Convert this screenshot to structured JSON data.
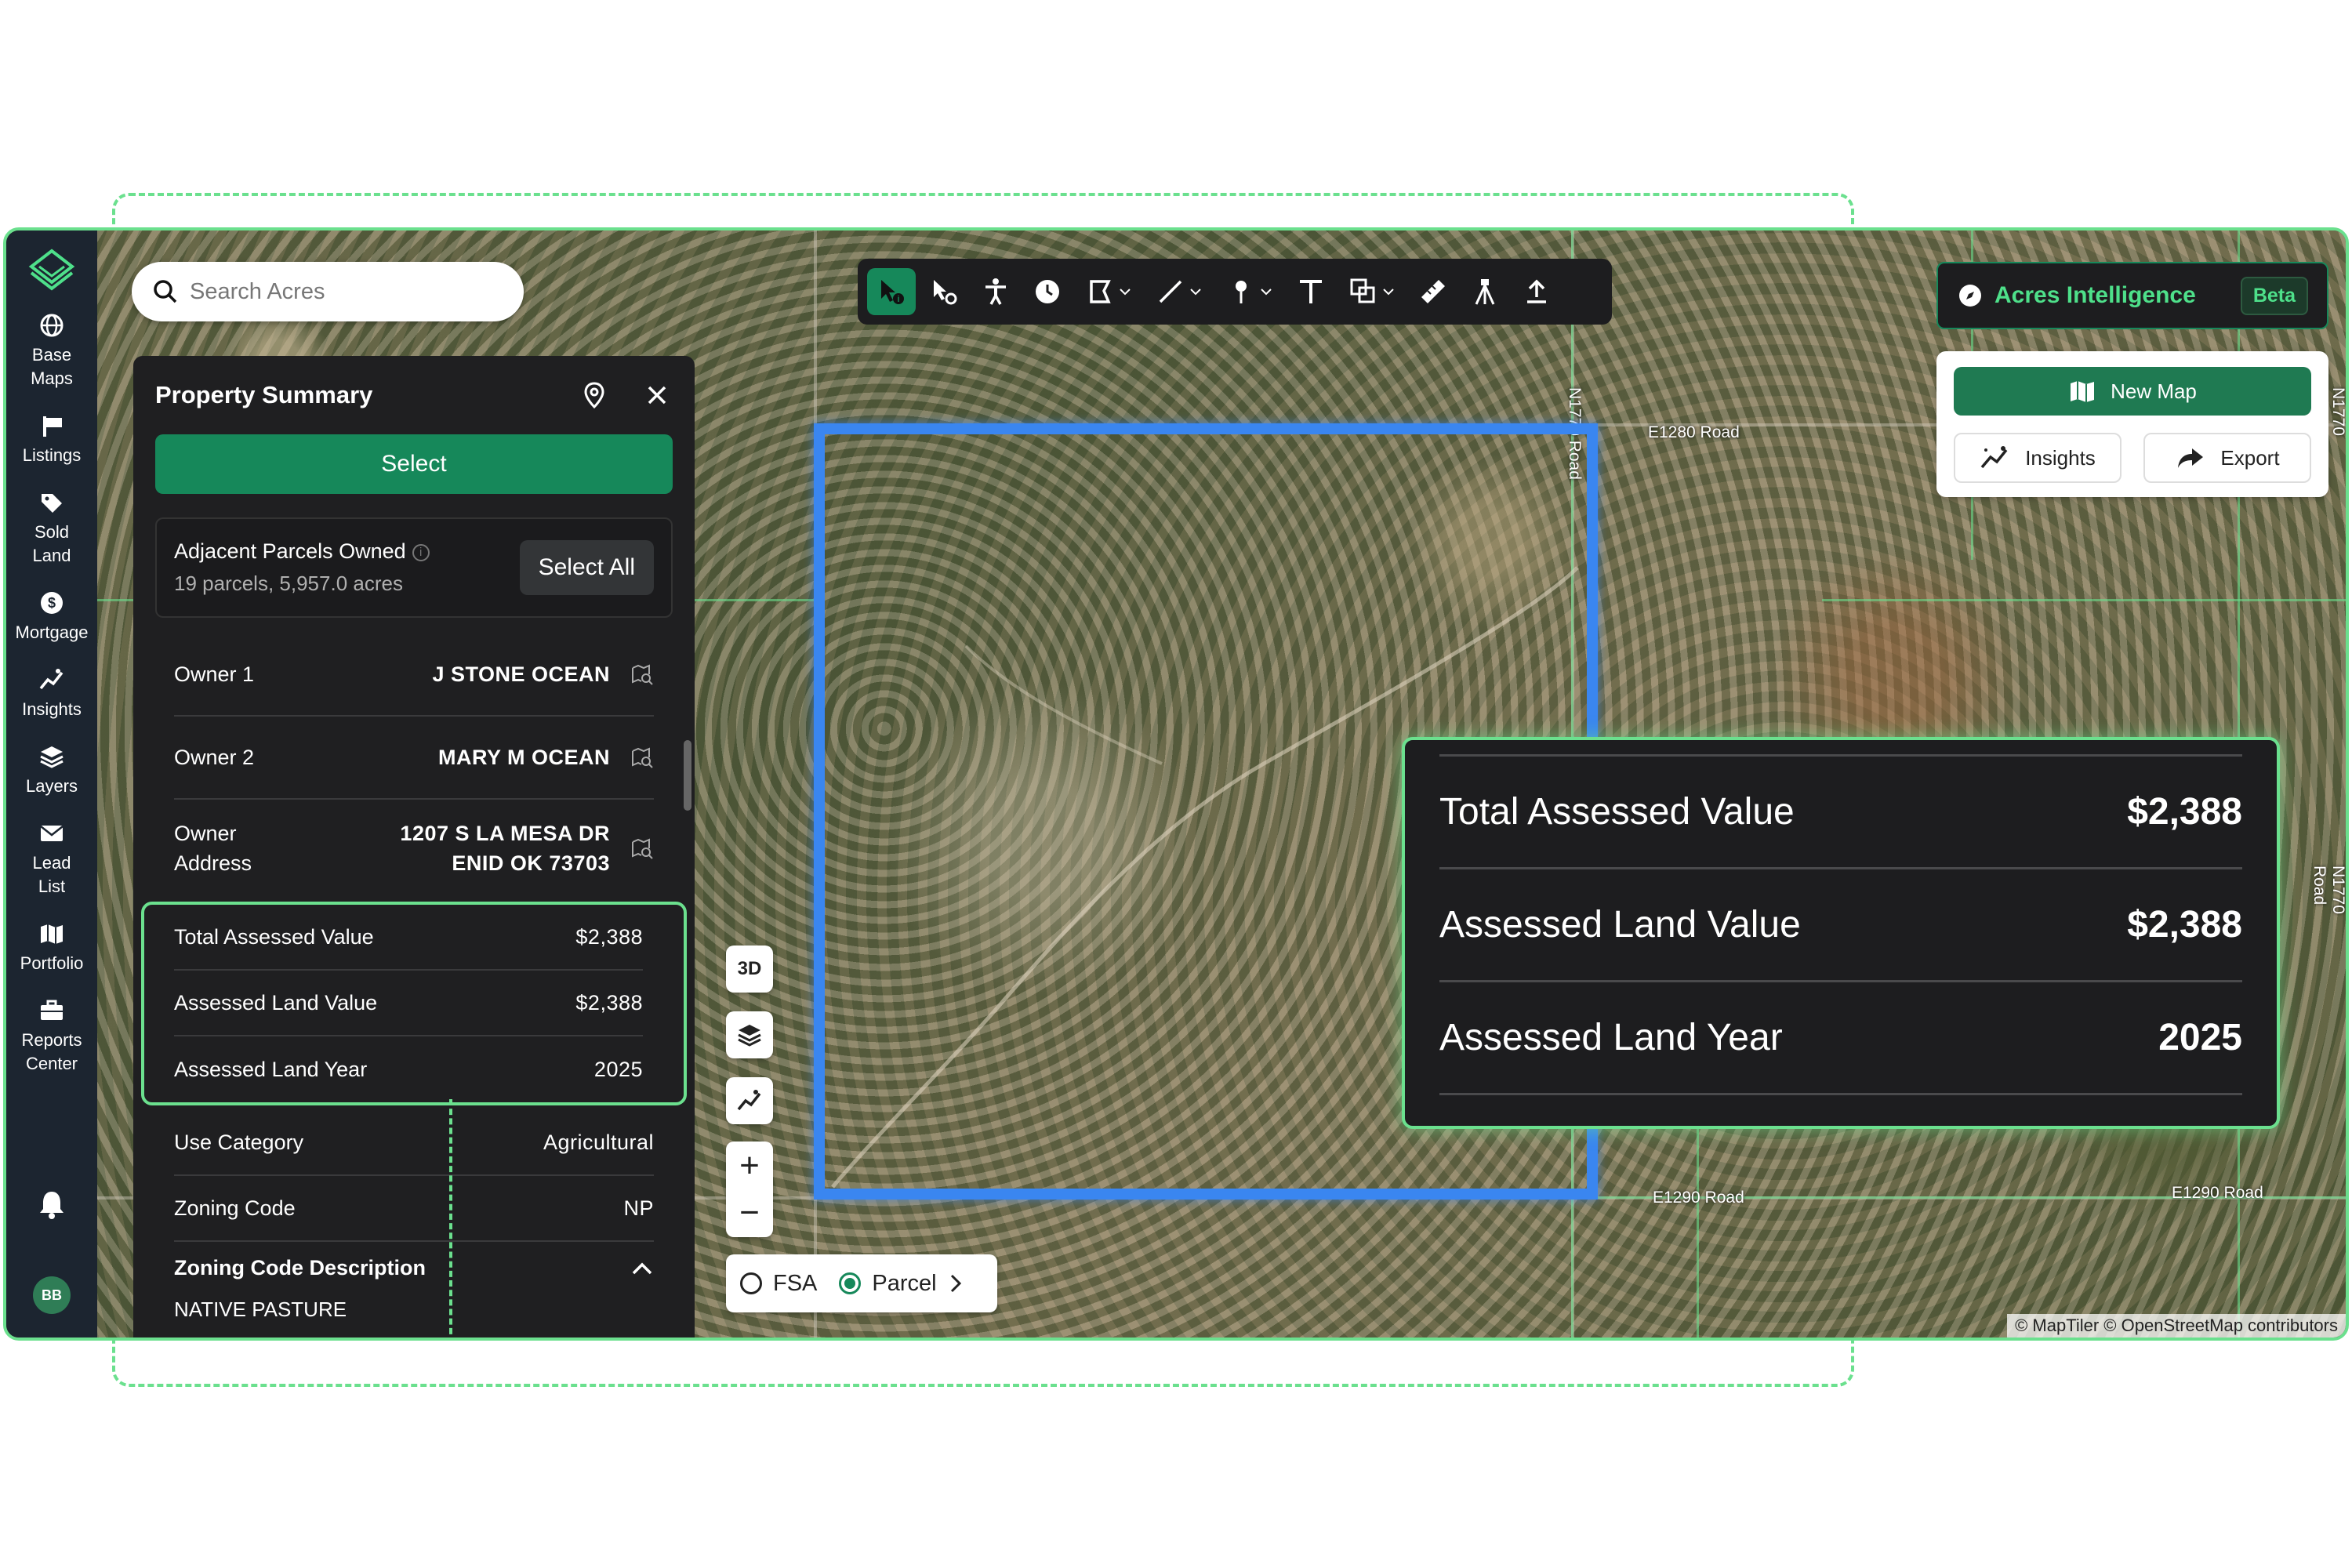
{
  "search": {
    "placeholder": "Search Acres"
  },
  "nav": {
    "items": [
      {
        "label": "Base\nMaps",
        "icon": "globe-icon"
      },
      {
        "label": "Listings",
        "icon": "listings-icon"
      },
      {
        "label": "Sold\nLand",
        "icon": "tag-icon"
      },
      {
        "label": "Mortgage",
        "icon": "dollar-icon"
      },
      {
        "label": "Insights",
        "icon": "insights-icon"
      },
      {
        "label": "Layers",
        "icon": "layers-icon"
      },
      {
        "label": "Lead\nList",
        "icon": "mail-icon"
      },
      {
        "label": "Portfolio",
        "icon": "map-icon"
      },
      {
        "label": "Reports\nCenter",
        "icon": "briefcase-icon"
      }
    ],
    "avatar": "BB"
  },
  "panel": {
    "title": "Property Summary",
    "select_label": "Select",
    "adjacent": {
      "title": "Adjacent Parcels Owned",
      "subtitle": "19 parcels, 5,957.0 acres",
      "button": "Select All"
    },
    "owner1": {
      "label": "Owner 1",
      "value": "J STONE OCEAN"
    },
    "owner2": {
      "label": "Owner 2",
      "value": "MARY M OCEAN"
    },
    "address": {
      "label": "Owner\nAddress",
      "value": "1207 S LA MESA DR\nENID OK 73703"
    },
    "assessed": [
      {
        "label": "Total Assessed Value",
        "value": "$2,388"
      },
      {
        "label": "Assessed Land Value",
        "value": "$2,388"
      },
      {
        "label": "Assessed Land Year",
        "value": "2025"
      }
    ],
    "use_category": {
      "label": "Use Category",
      "value": "Agricultural"
    },
    "zoning_code": {
      "label": "Zoning Code",
      "value": "NP"
    },
    "zoning_desc": {
      "label": "Zoning Code Description",
      "value": "NATIVE PASTURE"
    }
  },
  "map": {
    "roads": {
      "e1280": "E1280 Road",
      "e1290_a": "E1290 Road",
      "e1290_b": "E1290 Road",
      "n1": "N1770 Road",
      "n2": "N1770 Road",
      "n3": "N1770 Road"
    },
    "attribution": "© MapTiler © OpenStreetMap contributors",
    "btn_3d": "3D",
    "zoom_in": "+",
    "zoom_out": "−",
    "layer_toggle": {
      "fsa": "FSA",
      "parcel": "Parcel",
      "selected": "Parcel"
    }
  },
  "ai": {
    "title": "Acres Intelligence",
    "badge": "Beta"
  },
  "map_panel": {
    "new_map": "New Map",
    "insights": "Insights",
    "export": "Export"
  },
  "callout": [
    {
      "label": "Total Assessed Value",
      "value": "$2,388"
    },
    {
      "label": "Assessed Land Value",
      "value": "$2,388"
    },
    {
      "label": "Assessed Land Year",
      "value": "2025"
    }
  ],
  "colors": {
    "accent": "#16885a",
    "highlight": "#6be08e",
    "parcel_outline": "#3a86f0",
    "ai_green": "#4ee08a"
  }
}
